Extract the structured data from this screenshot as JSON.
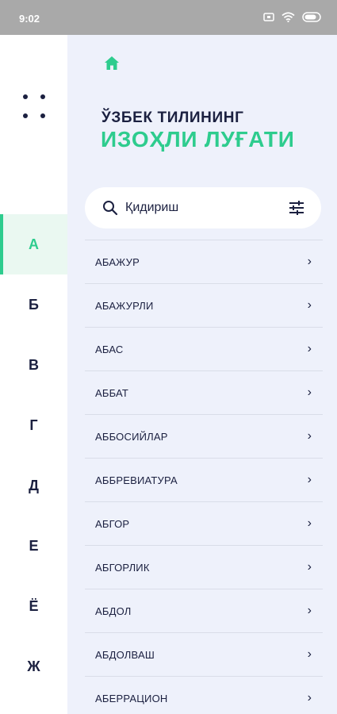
{
  "status_bar": {
    "time": "9:02",
    "battery_icon": "battery-icon",
    "wifi_icon": "wifi-icon",
    "screen_icon": "screen-icon"
  },
  "colors": {
    "accent": "#2ecc8e",
    "text": "#1b2040",
    "background": "#eef1fb"
  },
  "sidebar": {
    "menu_icon": "dots-grid-icon",
    "letters": [
      "А",
      "Б",
      "В",
      "Г",
      "Д",
      "Е",
      "Ё",
      "Ж"
    ],
    "active_letter": "А"
  },
  "header": {
    "home_icon": "home-icon",
    "title_line1": "ЎЗБЕК ТИЛИНИНГ",
    "title_line2": "ИЗОҲЛИ ЛУҒАТИ"
  },
  "search": {
    "placeholder": "Қидириш",
    "value": "",
    "icon": "search-icon",
    "filter_icon": "filter-icon"
  },
  "words": [
    {
      "label": "АБАЖУР"
    },
    {
      "label": "АБАЖУРЛИ"
    },
    {
      "label": "АБАС"
    },
    {
      "label": "АББАТ"
    },
    {
      "label": "АББОСИЙЛАР"
    },
    {
      "label": "АББРЕВИАТУРА"
    },
    {
      "label": "АБГОР"
    },
    {
      "label": "АБГОРЛИК"
    },
    {
      "label": "АБДОЛ"
    },
    {
      "label": "АБДОЛВАШ"
    },
    {
      "label": "АБЕРРАЦИОН"
    }
  ],
  "chevron": "›"
}
